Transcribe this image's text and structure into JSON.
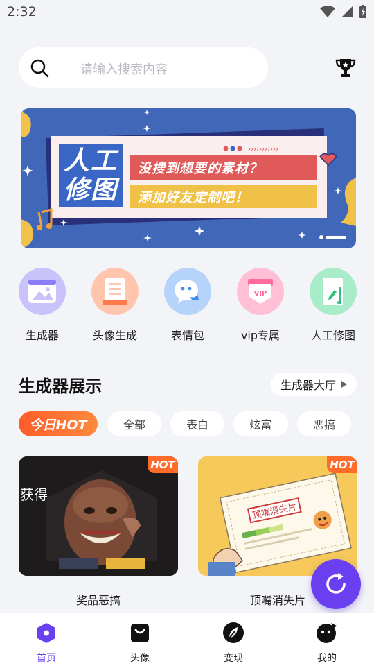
{
  "status_bar": {
    "time": "2:32"
  },
  "search": {
    "placeholder": "请输入搜索内容"
  },
  "banner": {
    "title_line1": "人工",
    "title_line2": "修图",
    "line1": "没搜到想要的素材？",
    "line2": "添加好友定制吧！"
  },
  "quick_items": [
    {
      "label": "生成器",
      "icon": "image-frame-icon",
      "color": "#8b7cf7",
      "bg": "#c9c2fb"
    },
    {
      "label": "头像生成",
      "icon": "document-icon",
      "color": "#ff7a4a",
      "bg": "#ffc6ad"
    },
    {
      "label": "表情包",
      "icon": "chat-face-icon",
      "color": "#3d8cf0",
      "bg": "#b6d4fb"
    },
    {
      "label": "vip专属",
      "icon": "vip-badge-icon",
      "color": "#ff6b9b",
      "bg": "#ffc0d5"
    },
    {
      "label": "人工修图",
      "icon": "edit-pen-icon",
      "color": "#2ec27e",
      "bg": "#a8ecc9"
    }
  ],
  "section": {
    "title": "生成器展示",
    "hall_button": "生成器大厅"
  },
  "chips": {
    "hot": "今日HOT",
    "items": [
      "全部",
      "表白",
      "炫富",
      "恶搞"
    ]
  },
  "cards": [
    {
      "label": "奖品恶搞",
      "tag": "HOT",
      "image_text": "获得"
    },
    {
      "label": "顶嘴消失片",
      "tag": "HOT",
      "image_text": "顶嘴消失片"
    }
  ],
  "tabs": [
    {
      "label": "首页",
      "icon": "home-icon",
      "active": true
    },
    {
      "label": "头像",
      "icon": "bag-icon",
      "active": false
    },
    {
      "label": "变现",
      "icon": "leaf-icon",
      "active": false
    },
    {
      "label": "我的",
      "icon": "profile-icon",
      "active": false
    }
  ],
  "colors": {
    "accent": "#6a3ff0",
    "hot": "#ff6b2b",
    "banner": "#4168b8"
  }
}
